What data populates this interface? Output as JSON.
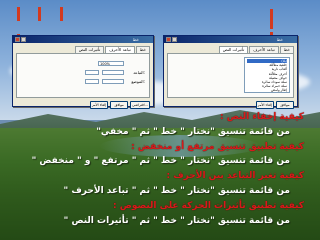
{
  "dialog_left": {
    "title": "خط",
    "tabs": [
      "خط",
      "تباعد الأحرف",
      "تأثيرات النص"
    ],
    "fields": [
      {
        "label": "التباعد:",
        "value": ""
      },
      {
        "label": "الموضع:",
        "value": ""
      },
      {
        "label": "بمقدار:",
        "value": ""
      }
    ],
    "spin_value": "100%",
    "buttons": [
      "موافق",
      "إلغاء الأمر",
      "افتراضي..."
    ]
  },
  "dialog_right": {
    "title": "خط",
    "tabs": [
      "خط",
      "تباعد الأحرف",
      "تأثيرات النص"
    ],
    "list_items": [
      "(بلا)",
      "خلفية متلألئة",
      "ألعاب نارية",
      "أحرف متلألئة",
      "حواف مضيئة",
      "نملة سوداء سائرة",
      "نملة حمراء سائرة",
      "إطار وامض"
    ],
    "selected_index": 0,
    "buttons": [
      "موافق",
      "إلغاء الأمر"
    ]
  },
  "lines": [
    {
      "type": "heading",
      "text": "كيفية إخفاء النص :"
    },
    {
      "type": "body",
      "text": "من قائمة تنسيق \"نختار \" خط \" ثم \" مخفي\""
    },
    {
      "type": "heading",
      "text": "كيفية تطبيق تنسيق مرتفع أو منخفض :"
    },
    {
      "type": "body",
      "text": "من قائمة تنسيق \"نختار \" خط \" ثم \" مرتفع \" و \" منخفض \""
    },
    {
      "type": "heading",
      "text": "كيفية تغير التباعد بين الأحرف :"
    },
    {
      "type": "body",
      "text": "من قائمة تنسيق \"نختار \" خط \" ثم \" تباعد الأحرف \""
    },
    {
      "type": "heading",
      "text": "كيفية تطبيق تأثيرات الحركة على النصوص :"
    },
    {
      "type": "body",
      "text": "من قائمة تنسيق \"نختار \" خط \" ثم \" تأثيرات النص \""
    }
  ],
  "colors": {
    "heading": "#d81a1a",
    "body": "#ffffff",
    "flag": "#d23a1f"
  }
}
